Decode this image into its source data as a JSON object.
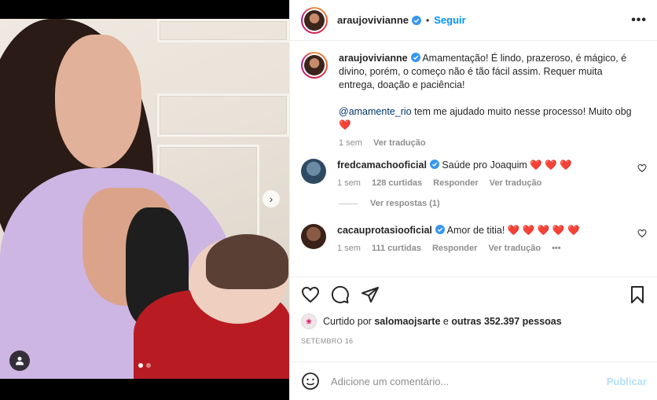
{
  "post": {
    "username": "araujovivianne",
    "follow_label": "Seguir",
    "separator": "•",
    "more_label": "•••"
  },
  "caption": {
    "username": "araujovivianne",
    "text_1": "Amamentação! É lindo, prazeroso, é mágico, é divino, porém, o começo não é tão fácil assim. Requer muita entrega, doação e paciência!",
    "mention": "@amamente_rio",
    "text_2": " tem me ajudado muito nesse processo! Muito obg ",
    "heart": "❤️",
    "time": "1 sem",
    "translate": "Ver tradução"
  },
  "comments": [
    {
      "username": "fredcamachooficial",
      "text": "Saúde pro Joaquim",
      "hearts": "❤️ ❤️ ❤️",
      "time": "1 sem",
      "likes": "128 curtidas",
      "reply": "Responder",
      "translate": "Ver tradução",
      "replies_label": "Ver respostas (1)"
    },
    {
      "username": "cacauprotasiooficial",
      "text": "Amor de titia!",
      "hearts": "❤️ ❤️ ❤️ ❤️ ❤️",
      "time": "1 sem",
      "likes": "111 curtidas",
      "reply": "Responder",
      "translate": "Ver tradução",
      "more": "•••"
    }
  ],
  "likes_line": {
    "prefix": "Curtido por",
    "user": "salomaojsarte",
    "middle": "e",
    "count": "outras 352.397 pessoas"
  },
  "date": "SETEMBRO 16",
  "add_comment": {
    "placeholder": "Adicione um comentário...",
    "publish": "Publicar"
  },
  "carousel": {
    "next_icon": "›",
    "slide_count": 2,
    "active_slide": 1
  },
  "colors": {
    "accent": "#0095f6",
    "verified": "#3897f0",
    "heart": "#ed4956",
    "muted": "#8e8e8e"
  },
  "icons": [
    "heart-outline-icon",
    "comment-icon",
    "share-icon",
    "bookmark-icon",
    "smile-icon",
    "user-tag-icon",
    "verified-icon"
  ]
}
